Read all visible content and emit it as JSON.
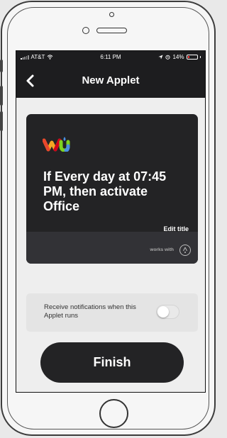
{
  "status_bar": {
    "carrier": "AT&T",
    "time": "6:11 PM",
    "battery": "14%"
  },
  "navbar": {
    "title": "New Applet",
    "back_icon": "chevron-left-icon"
  },
  "applet_card": {
    "service_logo": "wu",
    "title": "If Every day at 07:45 PM, then activate Office",
    "edit_label": "Edit title",
    "works_with_label": "works with"
  },
  "notifications": {
    "label": "Receive notifications when this Applet runs",
    "toggle_on": false
  },
  "finish_button": {
    "label": "Finish"
  },
  "colors": {
    "dark": "#232325",
    "footer": "#323236",
    "battery_low": "#ff3b3b"
  }
}
